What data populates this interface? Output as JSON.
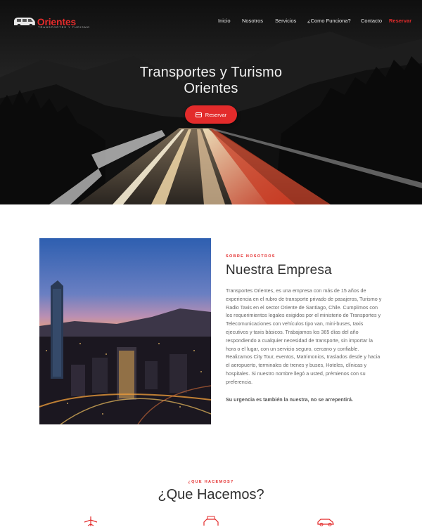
{
  "brand": {
    "name": "Orientes",
    "tagline": "TRANSPORTES Y TURISMO"
  },
  "nav": {
    "items": [
      {
        "label": "Inicio"
      },
      {
        "label": "Nosotros"
      },
      {
        "label": "Servicios"
      },
      {
        "label": "¿Como Funciona?"
      },
      {
        "label": "Contacto"
      }
    ],
    "reserve_label": "Reservar"
  },
  "hero": {
    "title_line1": "Transportes y Turismo",
    "title_line2": "Orientes",
    "button_label": "Reservar",
    "button_icon": "credit-card-icon"
  },
  "about": {
    "eyebrow": "SOBRE NOSOTROS",
    "title": "Nuestra Empresa",
    "body": "Transportes Orientes, es una empresa con más de 15 años de experiencia en el rubro de transporte privado de pasajeros, Turismo y Radio Taxis en el sector Oriente de Santiago, Chile. Cumplimos con los requerimientos legales exigidos por el ministerio de Transportes y Telecomunicaciones con vehículos tipo van, mini-buses, taxis ejecutivos y taxis básicos. Trabajamos los 365 días del año respondiendo a cualquier necesidad de transporte, sin importar la hora o el lugar, con un servicio seguro, cercano y confiable. Realizamos City Tour, eventos, Matrimonios, traslados desde y hacia el aeropuerto, terminales de trenes y buses, Hoteles, clínicas y hospitales. Si nuestro nombre llegó a usted, prémienos con su preferencia.",
    "tagline": "Su urgencia es también la nuestra, no se arrepentirá."
  },
  "services": {
    "eyebrow": "¿QUE HACEMOS?",
    "title": "¿Que Hacemos?",
    "icons": [
      "airplane-icon",
      "taxi-icon",
      "car-icon"
    ]
  },
  "colors": {
    "accent": "#e32b2b",
    "hero_dark": "#161616",
    "text": "#666666"
  }
}
